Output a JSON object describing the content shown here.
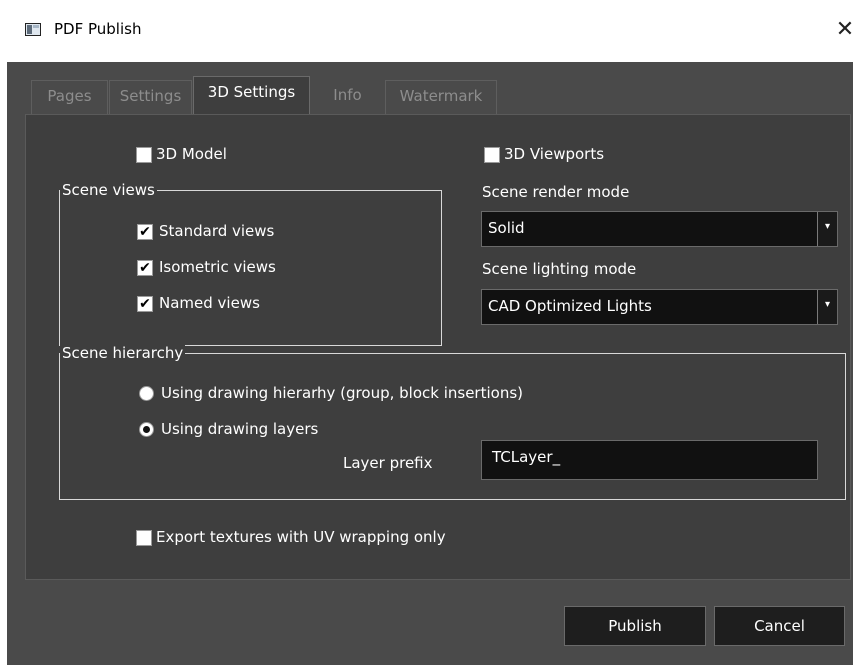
{
  "window": {
    "title": "PDF Publish"
  },
  "tabs": [
    {
      "label": "Pages"
    },
    {
      "label": "Settings"
    },
    {
      "label": "3D Settings"
    },
    {
      "label": "Info"
    },
    {
      "label": "Watermark"
    }
  ],
  "options": {
    "model_3d": {
      "label": "3D Model",
      "checked": false
    },
    "viewports_3d": {
      "label": "3D Viewports",
      "checked": false
    },
    "export_textures": {
      "label": "Export textures with UV wrapping only",
      "checked": false
    }
  },
  "scene_views": {
    "title": "Scene views",
    "items": [
      {
        "label": "Standard views",
        "checked": true
      },
      {
        "label": "Isometric views",
        "checked": true
      },
      {
        "label": "Named views",
        "checked": true
      }
    ]
  },
  "render_mode": {
    "label": "Scene render mode",
    "value": "Solid"
  },
  "lighting_mode": {
    "label": "Scene lighting mode",
    "value": "CAD Optimized Lights"
  },
  "scene_hierarchy": {
    "title": "Scene hierarchy",
    "options": [
      {
        "label": "Using drawing hierarhy (group, block insertions)",
        "selected": false
      },
      {
        "label": "Using drawing layers",
        "selected": true
      }
    ],
    "layer_prefix_label": "Layer prefix",
    "layer_prefix_value": "TCLayer_"
  },
  "buttons": {
    "publish": "Publish",
    "cancel": "Cancel"
  },
  "glyphs": {
    "close": "✕",
    "check": "✔",
    "dropdown": "▾"
  }
}
